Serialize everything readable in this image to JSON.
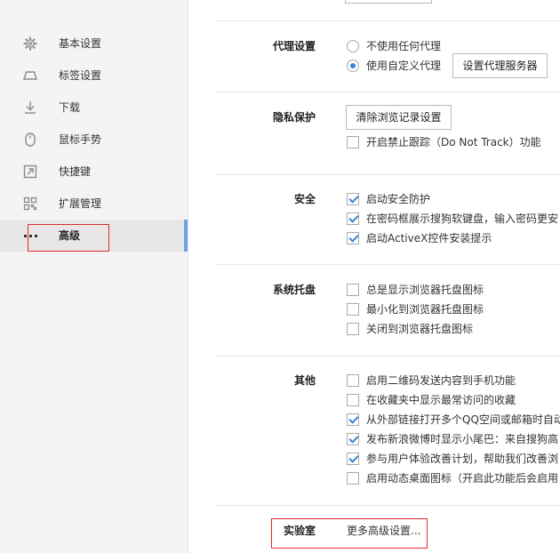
{
  "sidebar": {
    "items": [
      {
        "label": "基本设置",
        "icon": "gear-icon"
      },
      {
        "label": "标签设置",
        "icon": "tab-icon"
      },
      {
        "label": "下载",
        "icon": "download-icon"
      },
      {
        "label": "鼠标手势",
        "icon": "mouse-icon"
      },
      {
        "label": "快捷键",
        "icon": "shortcut-arrow-icon"
      },
      {
        "label": "扩展管理",
        "icon": "extensions-grid-icon"
      },
      {
        "label": "高级",
        "icon": "more-dots-icon"
      }
    ],
    "active_index": 6
  },
  "proxy": {
    "title": "代理设置",
    "option_none": "不使用任何代理",
    "option_custom": "使用自定义代理",
    "selected": "option_custom",
    "button": "设置代理服务器"
  },
  "privacy": {
    "title": "隐私保护",
    "button": "清除浏览记录设置",
    "dnt_label": "开启禁止跟踪（Do Not Track）功能",
    "dnt_checked": false
  },
  "security": {
    "title": "安全",
    "items": [
      {
        "label": "启动安全防护",
        "checked": true
      },
      {
        "label": "在密码框展示搜狗软键盘，输入密码更安",
        "checked": true
      },
      {
        "label": "启动ActiveX控件安装提示",
        "checked": true
      }
    ]
  },
  "tray": {
    "title": "系统托盘",
    "items": [
      {
        "label": "总是显示浏览器托盘图标",
        "checked": false
      },
      {
        "label": "最小化到浏览器托盘图标",
        "checked": false
      },
      {
        "label": "关闭到浏览器托盘图标",
        "checked": false
      }
    ]
  },
  "other": {
    "title": "其他",
    "items": [
      {
        "label": "启用二维码发送内容到手机功能",
        "checked": false
      },
      {
        "label": "在收藏夹中显示最常访问的收藏",
        "checked": false
      },
      {
        "label": "从外部链接打开多个QQ空间或邮箱时自动",
        "checked": true
      },
      {
        "label": "发布新浪微博时显示小尾巴：来自搜狗高",
        "checked": true
      },
      {
        "label": "参与用户体验改善计划，帮助我们改善浏",
        "checked": true
      },
      {
        "label": "启用动态桌面图标（开启此功能后会启用",
        "checked": false
      }
    ]
  },
  "lab": {
    "title": "实验室",
    "link": "更多高级设置..."
  },
  "colors": {
    "accent": "#3b83d6",
    "active_bar": "#6ea3e6",
    "highlight": "#e02a2a"
  }
}
